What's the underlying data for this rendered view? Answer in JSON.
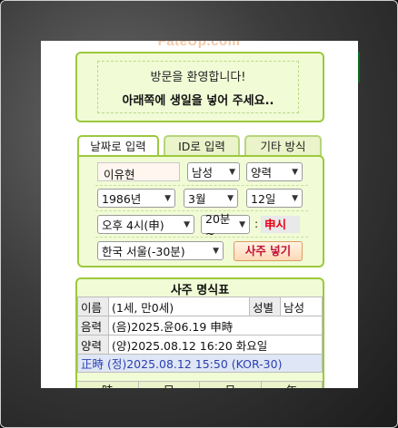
{
  "logo_text": "FateUp.com",
  "welcome": {
    "line1": "방문을 환영합니다!",
    "line2": "아래쪽에 생일을 넣어 주세요.."
  },
  "tabs": [
    {
      "label": "날짜로 입력",
      "active": true
    },
    {
      "label": "ID로 입력",
      "active": false
    },
    {
      "label": "기타 방식",
      "active": false
    }
  ],
  "form": {
    "name_value": "이유현",
    "gender": "남성",
    "calendar": "양력",
    "year": "1986년",
    "month": "3월",
    "day": "12일",
    "hour": "오후 4시(申)",
    "minute": "20분~",
    "colon": ":",
    "hour_label": "申시",
    "region": "한국 서울(-30분)",
    "submit_label": "사주 넣기"
  },
  "card": {
    "title": "사주 명식표",
    "rows": {
      "name_head": "이름",
      "name_value": "(1세, 만0세)",
      "gender_head": "성별",
      "gender_value": "남성",
      "lunar_head": "음력",
      "lunar_value": "(음)2025.윤06.19 申時",
      "solar_head": "양력",
      "solar_value": "(양)2025.08.12 16:20 화요일",
      "jeongsi": "正時 (정)2025.08.12 15:50 (KOR-30)"
    },
    "pillars": [
      "時",
      "日",
      "月",
      "年"
    ]
  },
  "colors": {
    "accent_green": "#9cc93c",
    "panel_bg": "#f1fbd6",
    "side_tab": "#0c6b1e",
    "hour_label_red": "#e60012"
  }
}
